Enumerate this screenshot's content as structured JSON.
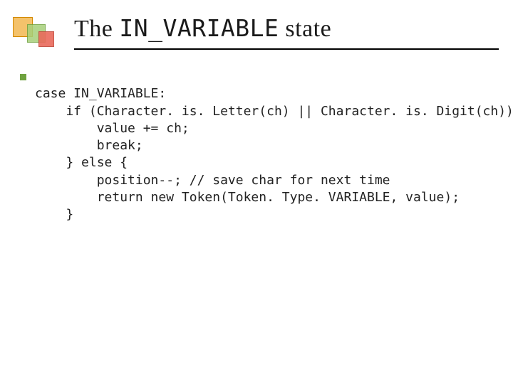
{
  "title": {
    "pre": "The ",
    "mono": "IN_VARIABLE",
    "post": " state"
  },
  "code": {
    "l1": "case IN_VARIABLE:",
    "l2": "    if (Character. is. Letter(ch) || Character. is. Digit(ch)) {",
    "l3": "        value += ch;",
    "l4": "        break;",
    "l5": "    } else {",
    "l6": "        position--; // save char for next time",
    "l7": "        return new Token(Token. Type. VARIABLE, value);",
    "l8": "    }"
  }
}
